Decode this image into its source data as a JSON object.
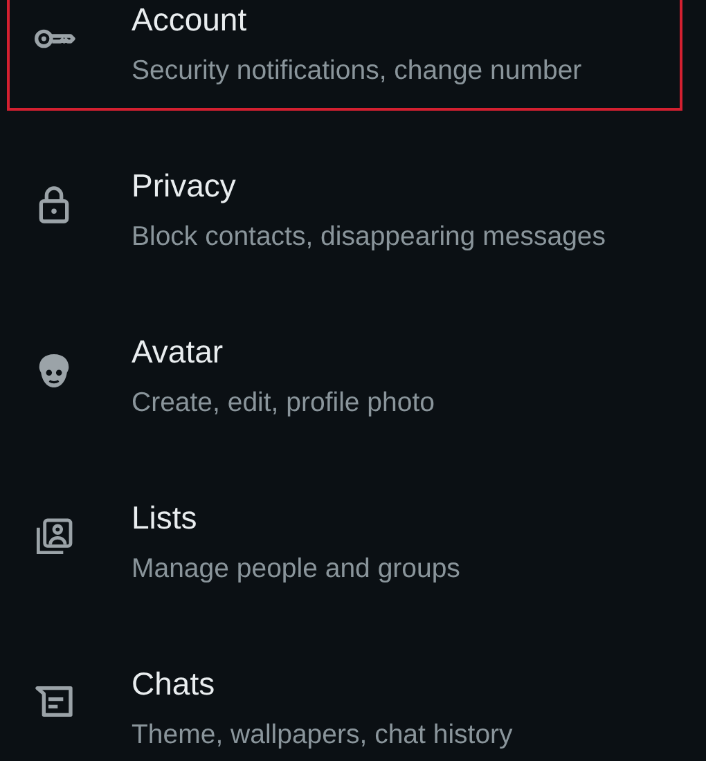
{
  "settings": [
    {
      "kind": "key",
      "title": "Account",
      "subtitle": "Security notifications, change number",
      "highlighted": true
    },
    {
      "kind": "lock",
      "title": "Privacy",
      "subtitle": "Block contacts, disappearing messages",
      "highlighted": false
    },
    {
      "kind": "avatar",
      "title": "Avatar",
      "subtitle": "Create, edit, profile photo",
      "highlighted": false
    },
    {
      "kind": "lists",
      "title": "Lists",
      "subtitle": "Manage people and groups",
      "highlighted": false
    },
    {
      "kind": "chats",
      "title": "Chats",
      "subtitle": "Theme, wallpapers, chat history",
      "highlighted": false
    }
  ]
}
